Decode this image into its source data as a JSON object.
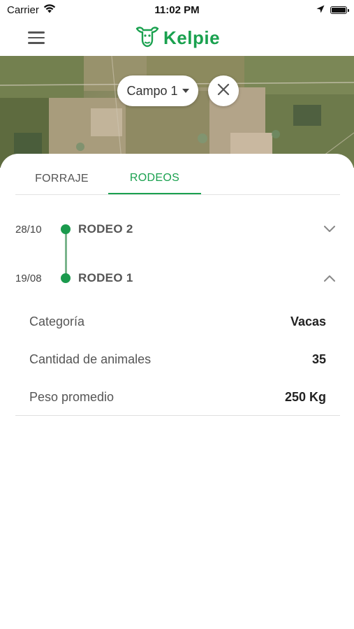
{
  "status_bar": {
    "carrier": "Carrier",
    "time": "11:02 PM"
  },
  "app": {
    "brand": "Kelpie",
    "brand_color": "#1aa14f"
  },
  "map": {
    "field_selector": "Campo 1",
    "icons": [
      "chevron-down-icon",
      "close-icon"
    ]
  },
  "tabs": [
    {
      "label": "FORRAJE",
      "active": false
    },
    {
      "label": "RODEOS",
      "active": true
    }
  ],
  "rodeos": [
    {
      "date": "28/10",
      "name": "RODEO 2",
      "expanded": false
    },
    {
      "date": "19/08",
      "name": "RODEO 1",
      "expanded": true
    }
  ],
  "details": [
    {
      "label": "Categoría",
      "value": "Vacas"
    },
    {
      "label": "Cantidad de animales",
      "value": "35"
    },
    {
      "label": "Peso promedio",
      "value": "250 Kg"
    }
  ]
}
